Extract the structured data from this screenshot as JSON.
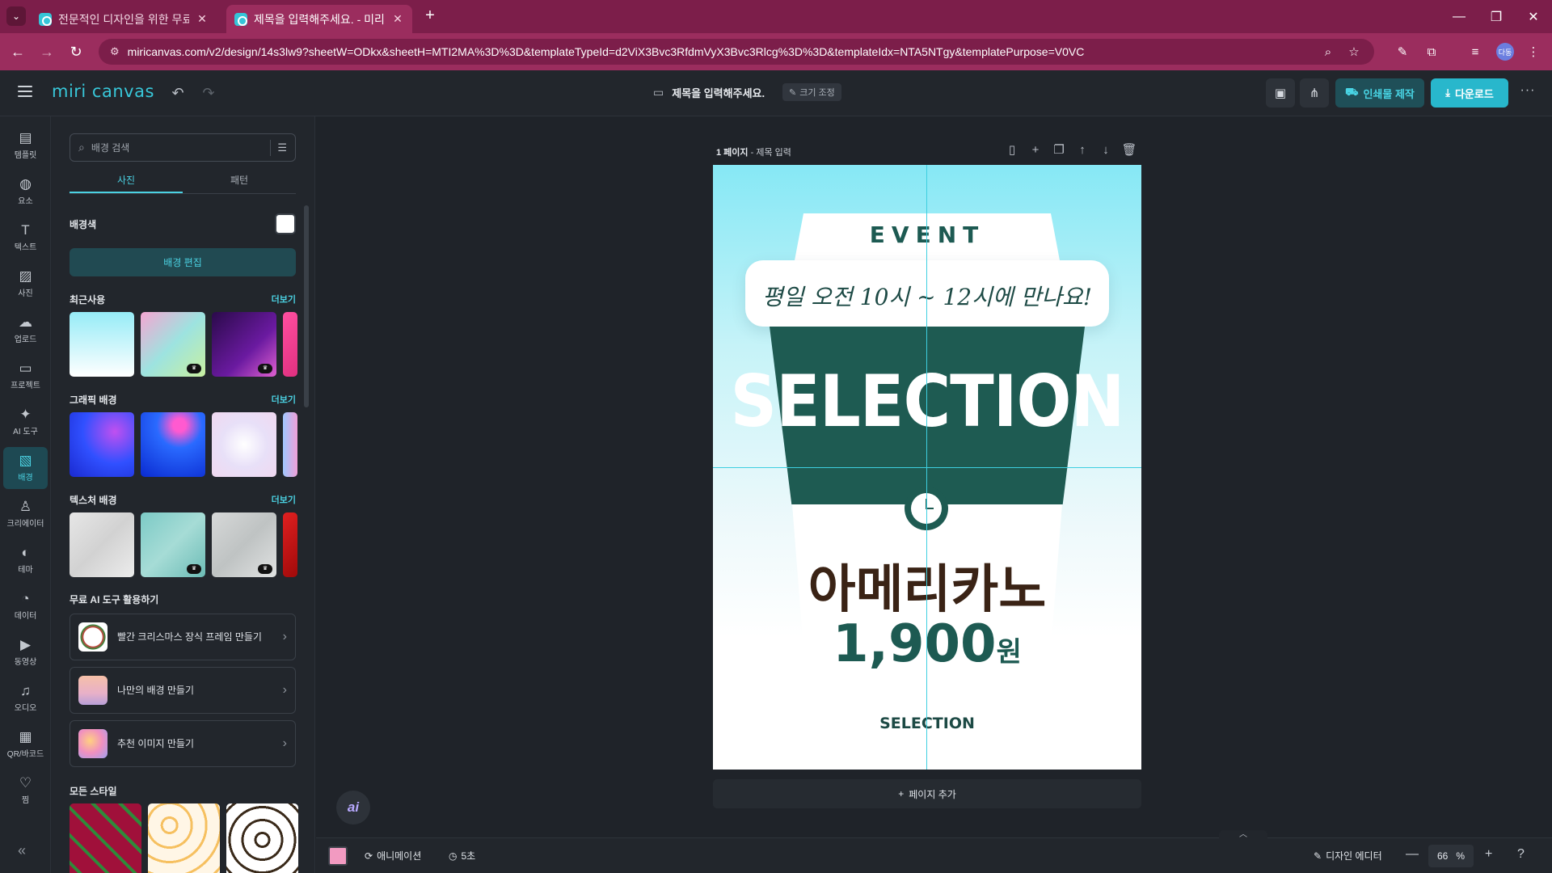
{
  "browser": {
    "tabs": [
      {
        "title": "전문적인 디자인을 위한 무료 ",
        "active": false
      },
      {
        "title": "제목을 입력해주세요. - 미리캔",
        "active": true
      }
    ],
    "url": "miricanvas.com/v2/design/14s3lw9?sheetW=ODkx&sheetH=MTI2MA%3D%3D&templateTypeId=d2ViX3Bvc3RfdmVyX3Bvc3Rlcg%3D%3D&templateIdx=NTA5NTgy&templatePurpose=V0VC",
    "profile_initials": "다동"
  },
  "header": {
    "logo": "miri canvas",
    "doc_title": "제목을 입력해주세요.",
    "resize_label": "크기 조정",
    "print_label": "인쇄물 제작",
    "download_label": "다운로드"
  },
  "rail": {
    "items": [
      {
        "label": "템플릿",
        "icon": "template-icon"
      },
      {
        "label": "요소",
        "icon": "elements-icon"
      },
      {
        "label": "텍스트",
        "icon": "text-icon"
      },
      {
        "label": "사진",
        "icon": "photo-icon"
      },
      {
        "label": "업로드",
        "icon": "upload-icon"
      },
      {
        "label": "프로젝트",
        "icon": "project-icon"
      },
      {
        "label": "AI 도구",
        "icon": "ai-tools-icon"
      },
      {
        "label": "배경",
        "icon": "background-icon"
      },
      {
        "label": "크리에이터",
        "icon": "creator-icon"
      },
      {
        "label": "테마",
        "icon": "theme-icon"
      },
      {
        "label": "데이터",
        "icon": "data-icon"
      },
      {
        "label": "동영상",
        "icon": "video-icon"
      },
      {
        "label": "오디오",
        "icon": "audio-icon"
      },
      {
        "label": "QR/바코드",
        "icon": "qr-icon"
      },
      {
        "label": "찜",
        "icon": "heart-icon"
      }
    ],
    "active_item": "배경"
  },
  "panel": {
    "search_placeholder": "배경 검색",
    "tabs": [
      "사진",
      "패턴"
    ],
    "active_tab": "사진",
    "bg_color_label": "배경색",
    "bg_color_value": "#ffffff",
    "bg_edit_label": "배경 편집",
    "more_label": "더보기",
    "sections": [
      {
        "title": "최근사용"
      },
      {
        "title": "그래픽 배경"
      },
      {
        "title": "텍스처 배경"
      }
    ],
    "ai_section_title": "무료 AI 도구 활용하기",
    "ai_cards": [
      {
        "label": "빨간 크리스마스 장식 프레임 만들기"
      },
      {
        "label": "나만의 배경 만들기"
      },
      {
        "label": "추천 이미지 만들기"
      }
    ],
    "style_section_title": "모든 스타일"
  },
  "canvas": {
    "page_number": "1 페이지",
    "page_title": "제목 입력",
    "add_page_label": "페이지 추가",
    "design": {
      "event": "EVENT",
      "script": "평일 오전 10시 ~ 12시에 만나요!",
      "selection": "SELECTION",
      "product": "아메리카노",
      "price": "1,900",
      "currency": "원",
      "footer": "SELECTION"
    }
  },
  "bottom": {
    "page_color": "#f29ac1",
    "animation_label": "애니메이션",
    "duration_label": "5초",
    "editor_label": "디자인 에디터",
    "zoom": "66",
    "zoom_unit": "%"
  }
}
